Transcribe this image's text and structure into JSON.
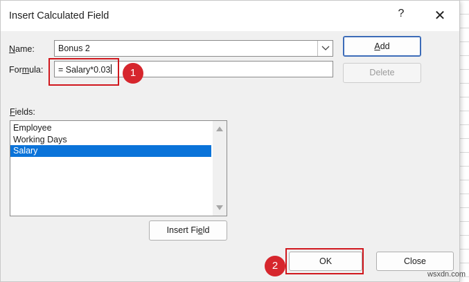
{
  "dialog": {
    "title": "Insert Calculated Field",
    "help_glyph": "?",
    "close_glyph": "✕"
  },
  "name": {
    "label": "Name:",
    "value": "Bonus 2"
  },
  "formula": {
    "label": "Formula:",
    "value": "= Salary*0.03"
  },
  "buttons": {
    "add": "Add",
    "delete": "Delete",
    "insert_field": "Insert Field",
    "ok": "OK",
    "close": "Close"
  },
  "fields": {
    "label": "Fields:",
    "items": [
      "Employee",
      "Working Days",
      "Salary"
    ],
    "selected": "Salary"
  },
  "annotations": {
    "step1": "1",
    "step2": "2",
    "highlight_color": "#d0161c"
  },
  "watermark": "wsxdn.com",
  "icons": [
    "chevron-down-icon",
    "close-icon",
    "help-icon",
    "scroll-up-icon",
    "scroll-down-icon"
  ]
}
